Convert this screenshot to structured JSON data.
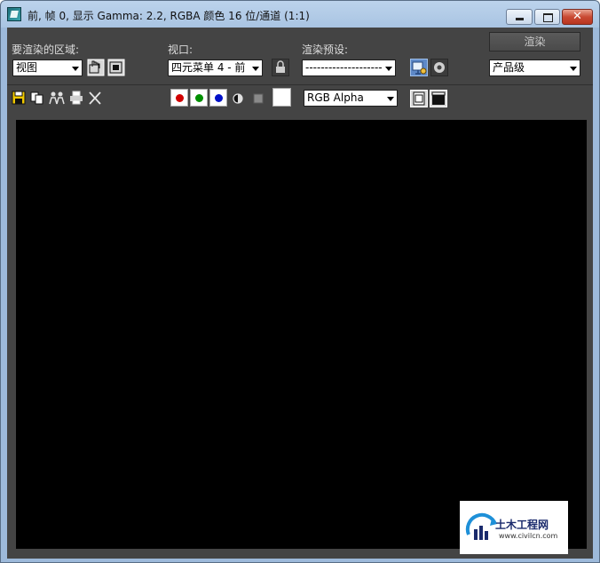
{
  "window": {
    "title": "前, 帧 0, 显示 Gamma: 2.2, RGBA 颜色 16 位/通道 (1:1)",
    "icon": "3ds-max-app-icon",
    "controls": {
      "minimize": "minimize-icon",
      "maximize": "maximize-icon",
      "close_glyph": "✕"
    }
  },
  "area_to_render": {
    "label": "要渲染的区域:",
    "value": "视图"
  },
  "viewport_select": {
    "label": "视口:",
    "value": "四元菜单 4 - 前"
  },
  "render_preset": {
    "label": "渲染预设:",
    "value": "--------------------"
  },
  "render_button": {
    "label": "渲染"
  },
  "production": {
    "value": "产品级"
  },
  "channel_select": {
    "value": "RGB Alpha"
  },
  "channel_colors": {
    "red": "#d10000",
    "green": "#008f00",
    "blue": "#0010c8"
  },
  "watermark": {
    "title": "土木工程网",
    "url": "www.civilcn.com"
  }
}
